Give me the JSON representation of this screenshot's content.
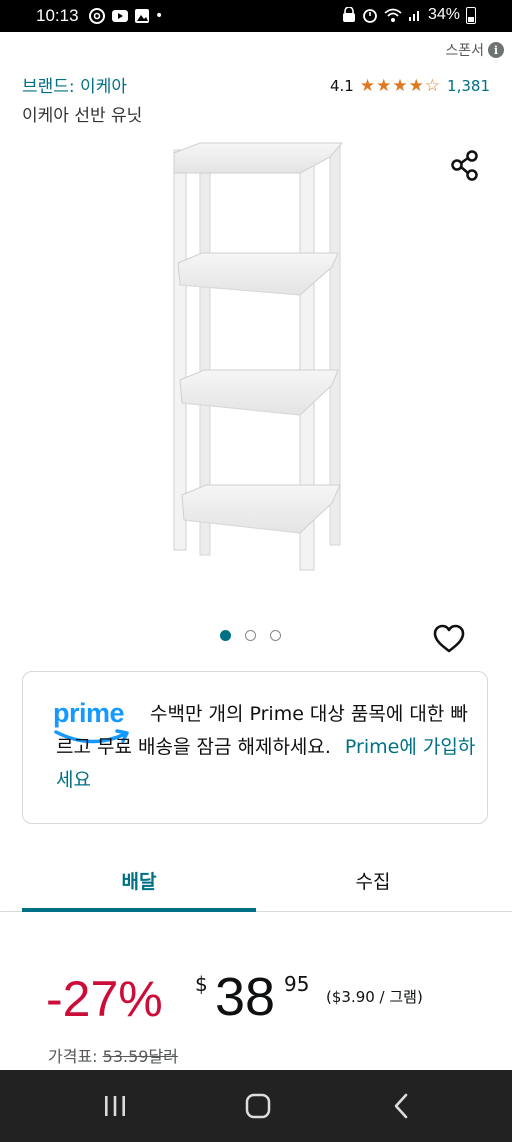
{
  "status_bar": {
    "time": "10:13",
    "battery": "34%",
    "left_icons": [
      "threads-icon",
      "youtube-icon",
      "gallery-icon",
      "notification-dot"
    ],
    "right_icons": [
      "vpn-icon",
      "alarm-icon",
      "wifi-icon",
      "signal-icon",
      "battery-icon"
    ]
  },
  "header": {
    "sponsored_label": "스폰서",
    "brand_link": "브랜드: 이케아",
    "rating_value": "4.1",
    "rating_stars": 4.1,
    "stars_glyphs": "★★★★☆",
    "rating_count": "1,381",
    "title": "이케아 선반 유닛"
  },
  "gallery": {
    "image_count": 3,
    "active_index": 0
  },
  "prime_banner": {
    "logo_text": "prime",
    "message": "수백만 개의 Prime 대상 품목에 대한 빠르고 무료 배송을 잠금 해제하세요.",
    "link": "Prime에 가입하세요"
  },
  "tabs": [
    {
      "label": "배달",
      "active": true
    },
    {
      "label": "수집",
      "active": false
    }
  ],
  "price": {
    "discount": "-27%",
    "currency": "$",
    "whole": "38",
    "fraction": "95",
    "unit_price": "($3.90 / 그램)",
    "list_label": "가격표:",
    "list_value": "53.59달러"
  },
  "colors": {
    "link": "#007185",
    "discount": "#cc0c39",
    "stars": "#de7921",
    "prime_blue": "#1399ff"
  }
}
